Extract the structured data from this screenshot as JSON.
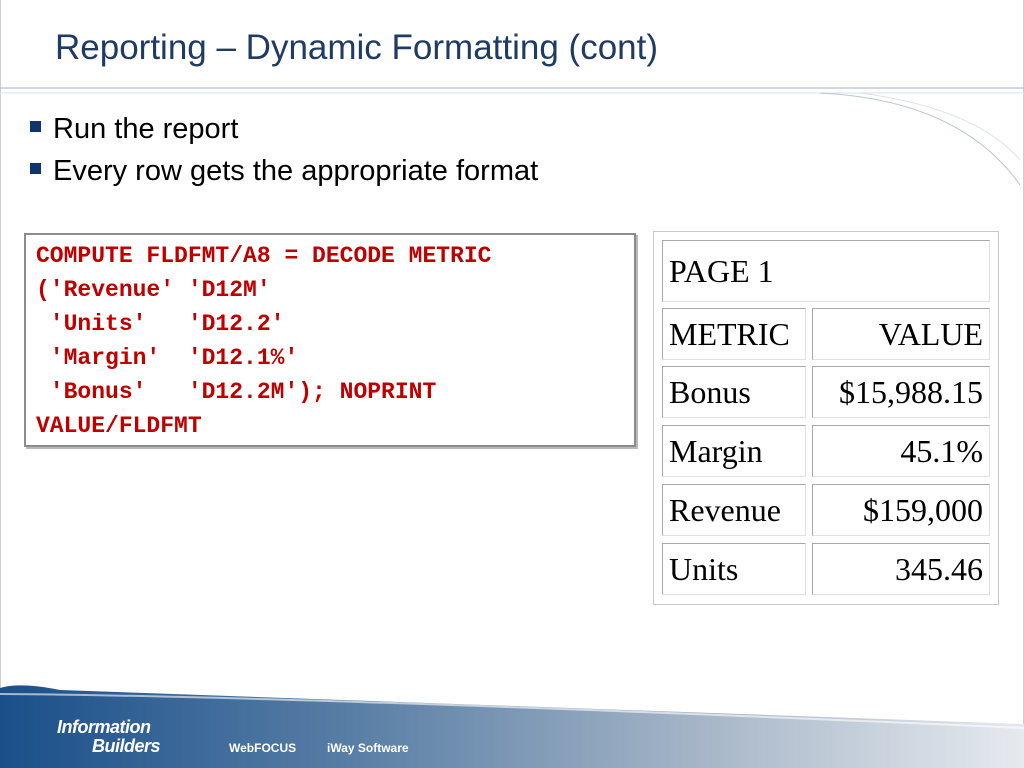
{
  "slide": {
    "title": "Reporting – Dynamic Formatting (cont)",
    "bullets": [
      "Run the report",
      "Every row gets the appropriate format"
    ]
  },
  "code": {
    "lines": [
      "COMPUTE FLDFMT/A8 = DECODE METRIC",
      "('Revenue' 'D12M'",
      " 'Units'   'D12.2'",
      " 'Margin'  'D12.1%'",
      " 'Bonus'   'D12.2M'); NOPRINT",
      "VALUE/FLDFMT"
    ]
  },
  "report": {
    "page_label": "PAGE 1",
    "headers": [
      "METRIC",
      "VALUE"
    ],
    "rows": [
      {
        "metric": "Bonus",
        "value": "$15,988.15"
      },
      {
        "metric": "Margin",
        "value": "45.1%"
      },
      {
        "metric": "Revenue",
        "value": "$159,000"
      },
      {
        "metric": "Units",
        "value": "345.46"
      }
    ]
  },
  "footer": {
    "logo_line1": "Information",
    "logo_line2": "Builders",
    "links": [
      "WebFOCUS",
      "iWay Software"
    ]
  },
  "colors": {
    "title": "#1f3b63",
    "bullet": "#10336b",
    "code": "#c00000",
    "footer": "#1a4f8a"
  }
}
